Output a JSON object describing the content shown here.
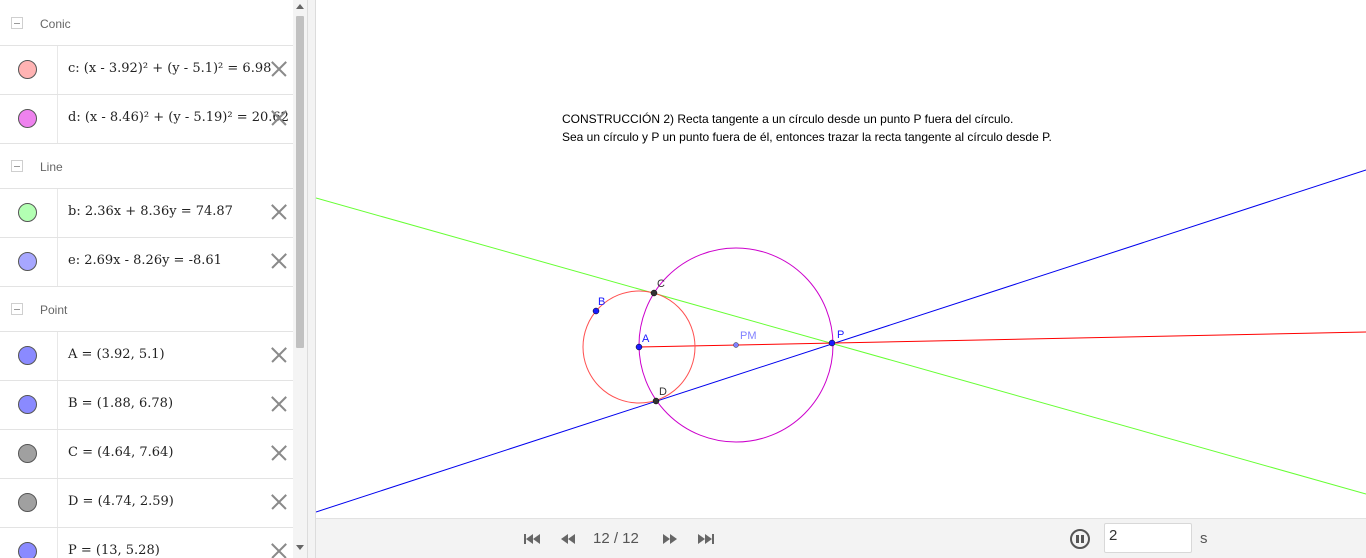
{
  "algebra": {
    "groups": [
      {
        "label": "Conic",
        "items": [
          {
            "text": "c: (x - 3.92)² + (y - 5.1)² = 6.98",
            "color": "#ffb3b3"
          },
          {
            "text": "d: (x - 8.46)² + (y - 5.19)² = 20.62",
            "color": "#ee82ee"
          }
        ]
      },
      {
        "label": "Line",
        "items": [
          {
            "text": "b: 2.36x + 8.36y = 74.87",
            "color": "#b3ffb3"
          },
          {
            "text": "e: 2.69x - 8.26y = -8.61",
            "color": "#a7a7ff"
          }
        ]
      },
      {
        "label": "Point",
        "items": [
          {
            "text": "A = (3.92, 5.1)",
            "color": "#8a8aff"
          },
          {
            "text": "B = (1.88, 6.78)",
            "color": "#8a8aff"
          },
          {
            "text": "C = (4.64, 7.64)",
            "color": "#a0a0a0"
          },
          {
            "text": "D = (4.74, 2.59)",
            "color": "#a0a0a0"
          },
          {
            "text": "P = (13, 5.28)",
            "color": "#8a8aff"
          }
        ]
      }
    ]
  },
  "graphics": {
    "description_line1": "CONSTRUCCIÓN 2) Recta tangente a un círculo desde un punto P fuera del círculo.",
    "description_line2": "Sea un círculo y P un punto fuera de él, entonces trazar la recta tangente al círculo desde P.",
    "point_labels": {
      "A": "A",
      "B": "B",
      "C": "C",
      "D": "D",
      "P": "P",
      "PM": "PM"
    },
    "colors": {
      "circle_c": "#ff5050",
      "circle_d": "#cc00cc",
      "line_b": "#66ff33",
      "line_e": "#0000ee",
      "ray": "#ff0000",
      "blue_point": "#1a1aff",
      "black_point": "#333333",
      "pm_point": "#8080ff"
    }
  },
  "playbar": {
    "counter": "12 / 12",
    "speed_value": "2",
    "speed_unit": "s"
  }
}
